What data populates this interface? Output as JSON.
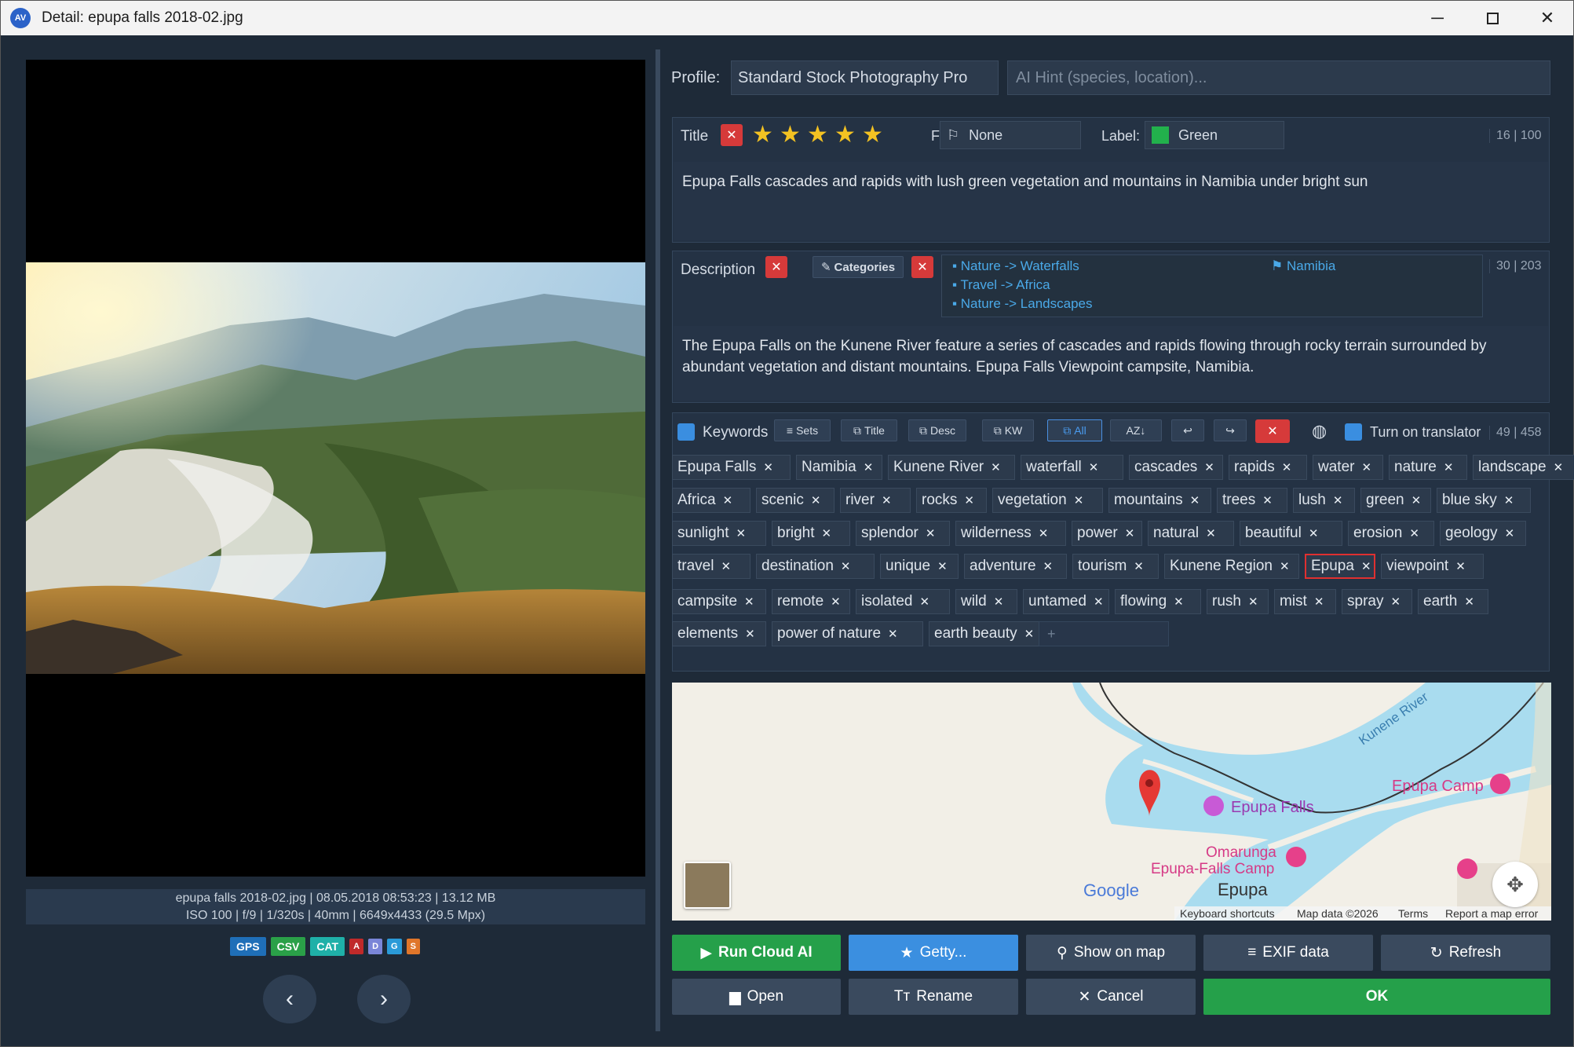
{
  "window": {
    "title": "Detail: epupa falls 2018-02.jpg",
    "app_icon": "AV"
  },
  "file_info": {
    "line1": "epupa falls 2018-02.jpg | 08.05.2018 08:53:23 | 13.12 MB",
    "line2": "ISO 100 | f/9 | 1/320s | 40mm | 6649x4433 (29.5 Mpx)"
  },
  "badges": [
    {
      "label": "GPS",
      "color": "#1f6fb8"
    },
    {
      "label": "CSV",
      "color": "#2aa048"
    },
    {
      "label": "CAT",
      "color": "#1fb0a8"
    },
    {
      "label": "A",
      "color": "#c02a2a"
    },
    {
      "label": "D",
      "color": "#7a86d8"
    },
    {
      "label": "G",
      "color": "#2a9ad8"
    },
    {
      "label": "S",
      "color": "#e0762a"
    }
  ],
  "nav": {
    "prev": "‹",
    "next": "›"
  },
  "profile": {
    "label": "Profile:",
    "value": "Standard Stock Photography Pro",
    "ai_hint_placeholder": "AI Hint (species, location)..."
  },
  "title_section": {
    "label": "Title",
    "rating": 5,
    "flag_label": "Flag:",
    "flag_value": "None",
    "label_label": "Label:",
    "label_value": "Green",
    "label_color": "#22b14c",
    "counter": "16 | 100",
    "text": "Epupa Falls cascades and rapids with lush green vegetation and mountains in Namibia under bright sun"
  },
  "description_section": {
    "label": "Description",
    "categories_button": "Categories",
    "categories": [
      "Nature -> Waterfalls",
      "Travel -> Africa",
      "Nature -> Landscapes"
    ],
    "country": "Namibia",
    "counter": "30 | 203",
    "text": "The Epupa Falls on the Kunene River feature a series of cascades and rapids flowing through rocky terrain surrounded by abundant vegetation and distant mountains. Epupa Falls Viewpoint campsite, Namibia."
  },
  "keywords_section": {
    "label": "Keywords",
    "toolbar": {
      "sets": "Sets",
      "title": "Title",
      "desc": "Desc",
      "kw": "KW",
      "all": "All",
      "sort": "AZ↓",
      "undo": "↩",
      "redo": "↪"
    },
    "translator_label": "Turn on translator",
    "counter": "49 | 458",
    "add_placeholder": "+",
    "keywords": [
      "Epupa Falls",
      "Namibia",
      "Kunene River",
      "waterfall",
      "cascades",
      "rapids",
      "water",
      "nature",
      "landscape",
      "Africa",
      "scenic",
      "river",
      "rocks",
      "vegetation",
      "mountains",
      "trees",
      "lush",
      "green",
      "blue sky",
      "sunlight",
      "bright",
      "splendor",
      "wilderness",
      "power",
      "natural",
      "beautiful",
      "erosion",
      "geology",
      "travel",
      "destination",
      "unique",
      "adventure",
      "tourism",
      "Kunene Region",
      "Epupa",
      "viewpoint",
      "campsite",
      "remote",
      "isolated",
      "wild",
      "untamed",
      "flowing",
      "rush",
      "mist",
      "spray",
      "earth",
      "elements",
      "power of nature",
      "earth beauty"
    ]
  },
  "map": {
    "labels": {
      "river": "Kunene River",
      "falls": "Epupa Falls",
      "camp1": "Epupa Camp",
      "camp2a": "Omarunga",
      "camp2b": "Epupa-Falls Camp",
      "town": "Epupa",
      "google": "Google"
    },
    "footer": {
      "shortcuts": "Keyboard shortcuts",
      "mapdata": "Map data ©2026",
      "terms": "Terms",
      "report": "Report a map error"
    }
  },
  "buttons": {
    "run_ai": "Run Cloud AI",
    "getty": "Getty...",
    "show_map": "Show on map",
    "exif": "EXIF data",
    "refresh": "Refresh",
    "open": "Open",
    "rename": "Rename",
    "cancel": "Cancel",
    "ok": "OK"
  }
}
